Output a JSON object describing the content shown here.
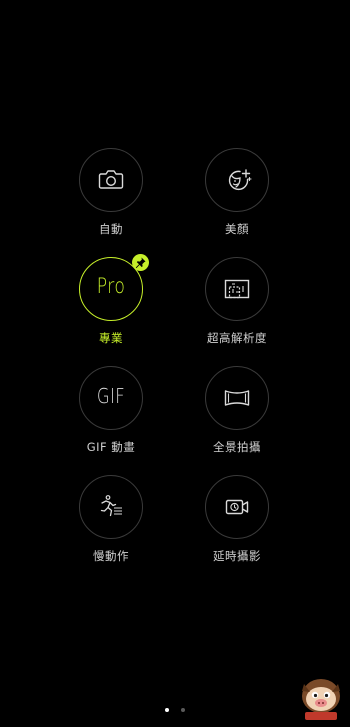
{
  "modes": [
    {
      "label": "自動",
      "icon": "camera-icon"
    },
    {
      "label": "美顏",
      "icon": "beauty-face-icon"
    },
    {
      "label": "專業",
      "icon": "pro-text",
      "icon_text": "Pro",
      "selected": true,
      "pinned": true
    },
    {
      "label": "超高解析度",
      "icon": "super-resolution-icon"
    },
    {
      "label": "GIF 動畫",
      "icon": "gif-text",
      "icon_text": "GIF"
    },
    {
      "label": "全景拍攝",
      "icon": "panorama-icon"
    },
    {
      "label": "慢動作",
      "icon": "slow-motion-icon"
    },
    {
      "label": "延時攝影",
      "icon": "time-lapse-icon"
    }
  ],
  "pager": {
    "page_count": 2,
    "current_page": 1
  },
  "colors": {
    "background": "#000000",
    "accent": "#c6ef2a",
    "ring": "#3a3a3a",
    "label": "#cfcfcf",
    "icon": "#dadada"
  }
}
